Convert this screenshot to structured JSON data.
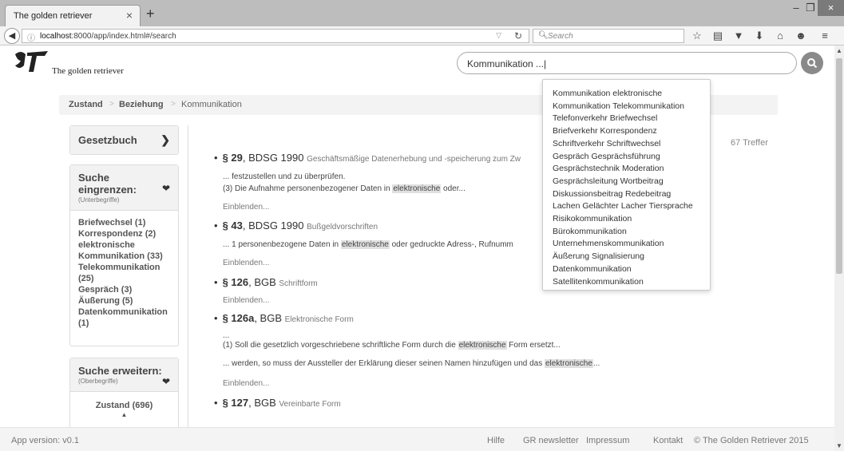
{
  "browser": {
    "tab_title": "The golden retriever",
    "tab_close": "×",
    "new_tab": "+",
    "win_min": "–",
    "win_max": "❐",
    "win_close": "×",
    "url_host": "localhost",
    "url_rest": ":8000/app/index.html#/search",
    "search_placeholder": "Search"
  },
  "header": {
    "logo_text": "The golden retriever",
    "search_value": "Kommunikation ...|"
  },
  "breadcrumb": {
    "items": [
      "Zustand",
      "Beziehung",
      "Kommunikation"
    ],
    "separator": ">"
  },
  "sidebar": {
    "gesetzbuch": "Gesetzbuch",
    "narrow_title": "Suche eingrenzen:",
    "narrow_sub": "(Unterbegriffe)",
    "narrow_items": [
      "Briefwechsel (1)",
      "Korrespondenz (2)",
      "elektronische",
      "Kommunikation (33)",
      "Telekommunikation",
      "(25)",
      "Gespräch (3)",
      "Äußerung (5)",
      "Datenkommunikation",
      "(1)"
    ],
    "expand_title": "Suche erweitern:",
    "expand_sub": "(Oberbegriffe)",
    "expand_item": "Zustand (696)"
  },
  "results": {
    "hits": "67 Treffer",
    "einblenden": "Einblenden...",
    "items": [
      {
        "para": "§ 29",
        "law": ", BDSG 1990",
        "desc": "Geschäftsmäßige Datenerhebung und -speicherung zum Zw"
      },
      {
        "para": "§ 43",
        "law": ", BDSG 1990",
        "desc": "Bußgeldvorschriften"
      },
      {
        "para": "§ 126",
        "law": ", BGB",
        "desc": "Schriftform"
      },
      {
        "para": "§ 126a",
        "law": ", BGB",
        "desc": "Elektronische Form"
      },
      {
        "para": "§ 127",
        "law": ", BGB",
        "desc": "Vereinbarte Form"
      }
    ],
    "snippets": {
      "r1a": "... festzustellen und zu überprüfen.",
      "r1b_pre": "(3) Die Aufnahme personenbezogener Daten in ",
      "r1b_hl": "elektronische",
      "r1b_post": " oder...",
      "r2_pre": "... 1 personenbezogene Daten in ",
      "r2_hl": "elektronische",
      "r2_post": " oder gedruckte Adress-, Rufnumm",
      "r4a": "...",
      "r4b_pre": "(1) Soll die gesetzlich vorgeschriebene schriftliche Form durch die ",
      "r4b_hl": "elektronische",
      "r4b_post": " Form ersetzt...",
      "r4c_pre": "... werden, so muss der Aussteller der Erklärung dieser seinen Namen hinzufügen und das ",
      "r4c_hl": "elektronische",
      "r4c_post": "..."
    }
  },
  "autocomplete": [
    "Kommunikation elektronische",
    "Kommunikation Telekommunikation",
    "Telefonverkehr Briefwechsel",
    "Briefverkehr Korrespondenz",
    "Schriftverkehr Schriftwechsel",
    "Gespräch Gesprächsführung",
    "Gesprächstechnik Moderation",
    "Gesprächsleitung Wortbeitrag",
    "Diskussionsbeitrag Redebeitrag",
    "Lachen Gelächter Lacher Tiersprache",
    "Risikokommunikation",
    "Bürokommunikation",
    "Unternehmenskommunikation",
    "Äußerung Signalisierung",
    "Datenkommunikation",
    "Satellitenkommunikation"
  ],
  "footer": {
    "version": "App version: v0.1",
    "hilfe": "Hilfe",
    "newsletter": "GR newsletter",
    "impressum": "Impressum",
    "kontakt": "Kontakt",
    "copyright": "© The Golden Retriever 2015"
  }
}
